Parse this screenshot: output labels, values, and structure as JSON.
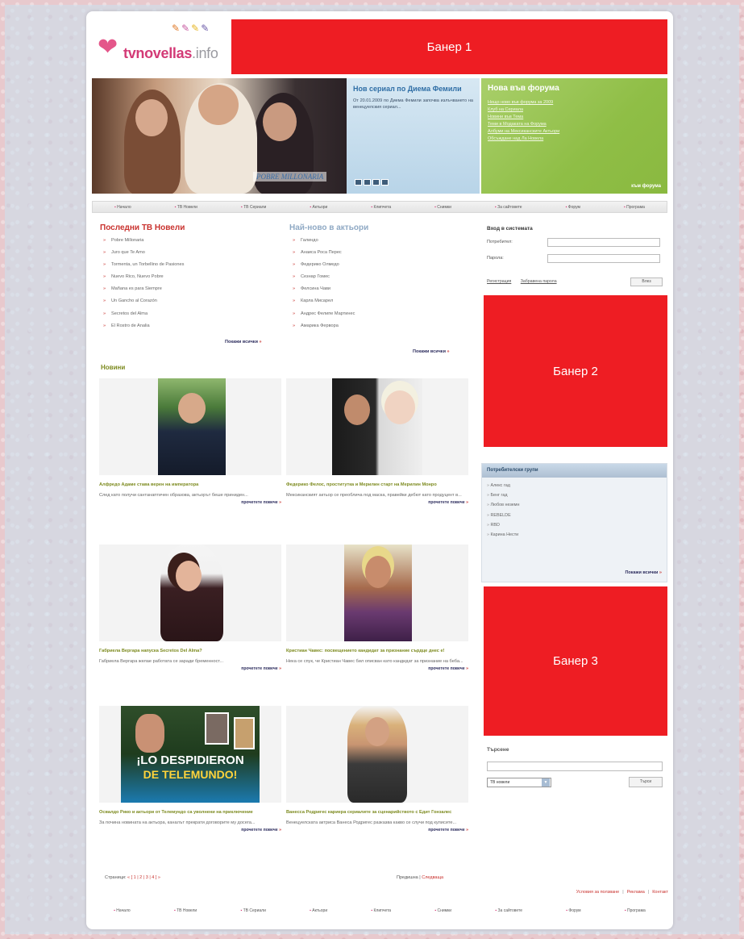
{
  "header": {
    "logo_text": "tvnovellas",
    "logo_tld": ".info",
    "banner1": "Банер 1"
  },
  "feature": {
    "show_logo": "POBRE MILLONARIA",
    "serial_title": "Нов сериал по Диема Фемили",
    "serial_text": "От 20.01.2009 по Диема Фемили започва излъчването на венецуелския сериал..."
  },
  "forum": {
    "title": "Нова във форума",
    "items": [
      "Нещо ново във форума за 2009",
      "Клуб на Сериала",
      "Новини във Тема",
      "Теми в Модаката на Форума",
      "Албуми на Мексиканските Актьори",
      "Обсъждане над Ла Новела"
    ],
    "more": "към форума"
  },
  "nav": {
    "items": [
      "Начало",
      "ТВ Новели",
      "ТВ Сериали",
      "Актьори",
      "Клипчета",
      "Снимки",
      "За сайтовете",
      "Форум",
      "Програма"
    ]
  },
  "latest_novelas": {
    "title": "Последни ТВ Новели",
    "items": [
      "Pobre Millonaria",
      "Juro que Te Amo",
      "Tormenta, un Torbellino de Pasiones",
      "Nuevo Rico, Nuevo Pobre",
      "Mañana es para Siempre",
      "Un Gancho al Corazón",
      "Secretos del Alma",
      "El Rostro de Analia"
    ],
    "show_all": "Покажи всички"
  },
  "latest_actors": {
    "title": "Най-ново в актьори",
    "items": [
      "Галиндо",
      "Анаиса Роса Перес",
      "Федерико Олмедо",
      "Сезнар Гомес",
      "Фелсина Чави",
      "Карла Мисарел",
      "Андрес Фелипе Мартинес",
      "Амарика Фервора"
    ],
    "show_all": "Покажи всички"
  },
  "news": {
    "title": "Новини",
    "cards": [
      {
        "headline": "Алфредо Адаме става верен на императора",
        "text": "След като получи сантанаптичен образова, актьорът беше приниден...",
        "more": "прочетете повече"
      },
      {
        "headline": "Федерико Фелос, проститутка и Мерилин старт на Мерилин Монро",
        "text": "Мексиканският актьор се преоблича под маска, правейки дебют като продуцент в...",
        "more": "прочетете повече"
      },
      {
        "headline": "Габриела Вергара напуска Secretos Del Alma?",
        "text": "Габриела Вергара желае работата се заради бременност...",
        "more": "прочетете повече"
      },
      {
        "headline": "Кристиан Чавес: посвещението кандидат за признание сърдце днес е!",
        "text": "Нека се спук, че Кристиан Чавес бил описван като кандидат за признание на беба...",
        "more": "прочетете повече"
      },
      {
        "headline": "Освалдо Рико и актьори от Телемундо са уволнени на приключение",
        "text": "За почина новината на актьора, каналът прекрати договорите му досега...",
        "more": "прочетете повече"
      },
      {
        "headline": "Ванесса Родригес кариера сериалите за сценарийството с Едит Гонзалес",
        "text": "Венецуелската актриса Ванеса Родригес разказва какво се случи под кулисите...",
        "more": "прочетете повече"
      }
    ],
    "magazine_line1": "¡LO DESPIDIERON",
    "magazine_line2": "DE TELEMUNDO!"
  },
  "pagination": {
    "label": "Страници:",
    "pages": "« [ 1 | 2 | 3 | 4 ] »",
    "prev_next_label": "Предишна |",
    "next": "Следваща"
  },
  "login": {
    "title": "Вход в системата",
    "user_label": "Потребител:",
    "pass_label": "Парола:",
    "register": "Регистрация",
    "forgot": "Забравена парола",
    "submit": "Влез"
  },
  "banner2": "Банер 2",
  "groups": {
    "title": "Потребителски групи",
    "items": [
      "Алекс гад",
      "Бенг гад",
      "Любов неземн",
      "REBELDE",
      "RBD",
      "Карина Нести"
    ],
    "show_all": "Покажи всички"
  },
  "banner3": "Банер 3",
  "search": {
    "title": "Търсене",
    "select_value": "ТВ новели",
    "button": "Търси"
  },
  "footer": {
    "links": [
      "Условия за ползване",
      "Реклама",
      "Контакт"
    ]
  }
}
